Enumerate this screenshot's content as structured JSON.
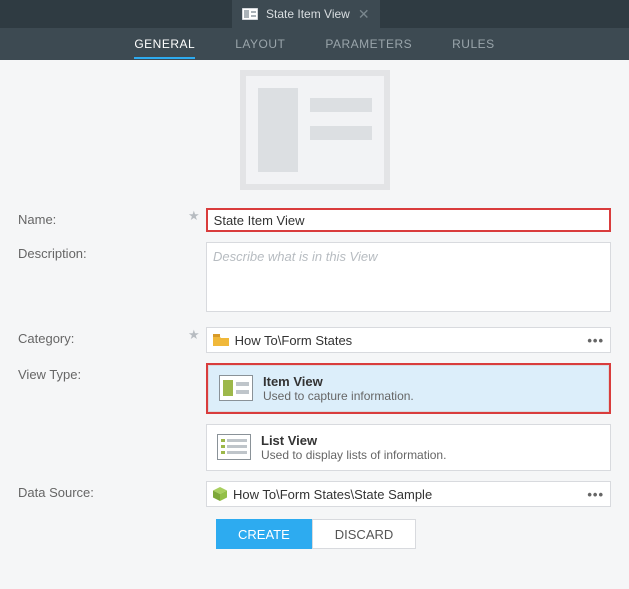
{
  "doc_tab": {
    "title": "State Item View"
  },
  "nav": {
    "general": "GENERAL",
    "layout": "LAYOUT",
    "parameters": "PARAMETERS",
    "rules": "RULES"
  },
  "labels": {
    "name": "Name:",
    "description": "Description:",
    "category": "Category:",
    "view_type": "View Type:",
    "data_source": "Data Source:"
  },
  "fields": {
    "name_value": "State Item View",
    "description_placeholder": "Describe what is in this View",
    "category_value": "How To\\Form States",
    "data_source_value": "How To\\Form States\\State Sample"
  },
  "view_types": {
    "item": {
      "title": "Item View",
      "desc": "Used to capture information."
    },
    "list": {
      "title": "List View",
      "desc": "Used to display lists of information."
    }
  },
  "buttons": {
    "create": "CREATE",
    "discard": "DISCARD"
  },
  "glyphs": {
    "ellipsis": "•••",
    "star": "★",
    "close": "✕"
  }
}
